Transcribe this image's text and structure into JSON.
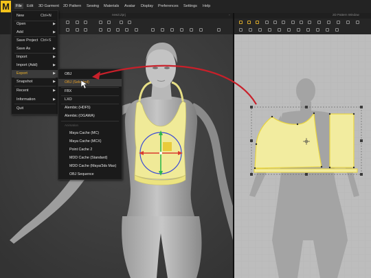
{
  "app": {
    "logo_letter": "M",
    "accent": "#f3c21a"
  },
  "menubar": {
    "items": [
      "File",
      "Edit",
      "3D Garment",
      "2D Pattern",
      "Sewing",
      "Materials",
      "Avatar",
      "Display",
      "Preferences",
      "Settings",
      "Help"
    ]
  },
  "subbar": {
    "project_title": "new3.Zprj",
    "pattern_window_title": "2D Pattern Window"
  },
  "file_menu": {
    "new": {
      "label": "New",
      "shortcut": "Ctrl+N"
    },
    "open": "Open",
    "add": "Add",
    "save_project": {
      "label": "Save Project",
      "shortcut": "Ctrl+S"
    },
    "save_as": "Save As",
    "import": "Import",
    "import_add": "Import (Add)",
    "export": "Export",
    "snapshot": "Snapshot",
    "recent": "Recent",
    "information": "Information",
    "quit": "Quit"
  },
  "export_menu": {
    "obj": "OBJ",
    "obj_selected": "OBJ (Selected)",
    "fbx": "FBX",
    "lxo": "LXO",
    "alembic_hdf5": "Alembic (HDF5)",
    "alembic_ogawa": "Alembic (OGAWA)",
    "animation_header": "Animation",
    "maya_cache_mc": "Maya Cache (MC)",
    "maya_cache_mcx": "Maya Cache (MCX)",
    "point_cache_2": "Point Cache 2",
    "mdd_cache_standard": "MDD Cache (Standard)",
    "mdd_cache_maya3ds": "MDD Cache (Maya/3ds Max)",
    "obj_sequence": "OBJ Sequence"
  },
  "colors": {
    "highlight_text": "#e8a02a",
    "garment": "#f2ee9c",
    "annotation_arrow": "#c8202a",
    "pattern_bg": "#bdbdbd"
  }
}
